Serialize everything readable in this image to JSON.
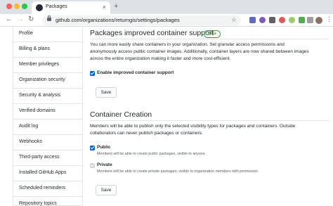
{
  "browser": {
    "tab_title": "Packages",
    "url": "github.com/organizations/returngis/settings/packages",
    "accent": "#0366d6"
  },
  "sidebar": {
    "items": [
      {
        "label": "Profile"
      },
      {
        "label": "Billing & plans"
      },
      {
        "label": "Member privileges"
      },
      {
        "label": "Organization security"
      },
      {
        "label": "Security & analysis"
      },
      {
        "label": "Verified domains"
      },
      {
        "label": "Audit log"
      },
      {
        "label": "Webhooks"
      },
      {
        "label": "Third-party access"
      },
      {
        "label": "Installed GitHub Apps"
      },
      {
        "label": "Scheduled reminders"
      },
      {
        "label": "Repository topics"
      }
    ]
  },
  "container_support": {
    "title": "Packages improved container support",
    "badge": "beta",
    "description_lines": [
      "You can more easily share containers in your organization. Set granular access permissions and",
      "anonymously access public container images. Additionally, container layers are now shared between images",
      "across the entire organization making it faster and more cost-efficient."
    ],
    "checkbox_label": "Enable improved container support",
    "save_label": "Save"
  },
  "container_creation": {
    "title": "Container Creation",
    "description_lines": [
      "Members will be able to publish only the selected visibility types for packages and containers. Outside",
      "collaborators can never publish packages or containers."
    ],
    "public_label": "Public",
    "public_hint": "Members will be able to create public packages, visible to anyone.",
    "private_label": "Private",
    "private_hint": "Members will be able to create private packages, visible to organization members with permission.",
    "save_label": "Save"
  }
}
